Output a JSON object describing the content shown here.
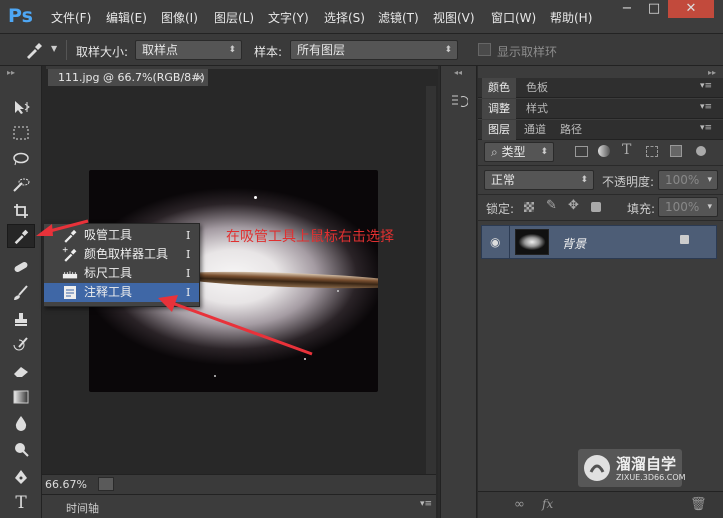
{
  "menu": {
    "logo": "Ps",
    "items": [
      "文件(F)",
      "编辑(E)",
      "图像(I)",
      "图层(L)",
      "文字(Y)",
      "选择(S)",
      "滤镜(T)",
      "视图(V)",
      "窗口(W)",
      "帮助(H)"
    ]
  },
  "window_controls": {
    "minimize": "−",
    "maximize": "□",
    "close": "✕"
  },
  "options": {
    "size_label": "取样大小:",
    "size_value": "取样点",
    "sample_label": "样本:",
    "sample_value": "所有图层",
    "ring_label": "显示取样环"
  },
  "document": {
    "tab_title": "111.jpg @ 66.7%(RGB/8#)",
    "tab_close": "×",
    "zoom": "66.67%"
  },
  "timeline_label": "时间轴",
  "flyout": {
    "items": [
      {
        "label": "吸管工具",
        "shortcut": "I",
        "icon": "eyedropper-icon"
      },
      {
        "label": "颜色取样器工具",
        "shortcut": "I",
        "icon": "color-sampler-icon"
      },
      {
        "label": "标尺工具",
        "shortcut": "I",
        "icon": "ruler-icon"
      },
      {
        "label": "注释工具",
        "shortcut": "I",
        "icon": "note-icon",
        "selected": true
      }
    ]
  },
  "annotation_text": "在吸管工具上鼠标右击选择",
  "annotation_color": "#e03030",
  "panels": {
    "top_tabs": [
      "颜色",
      "色板"
    ],
    "mid_tabs": [
      "调整",
      "样式"
    ],
    "layer_tabs": [
      "图层",
      "通道",
      "路径"
    ],
    "filter_label": "类型",
    "blend_mode": "正常",
    "opacity_label": "不透明度:",
    "opacity_value": "100%",
    "lock_label": "锁定:",
    "fill_label": "填充:",
    "fill_value": "100%",
    "layer_name": "背景",
    "layer_highlight_color": "#4d5d76"
  },
  "watermark": {
    "title": "溜溜自学",
    "url": "ZIXUE.3D66.COM"
  }
}
